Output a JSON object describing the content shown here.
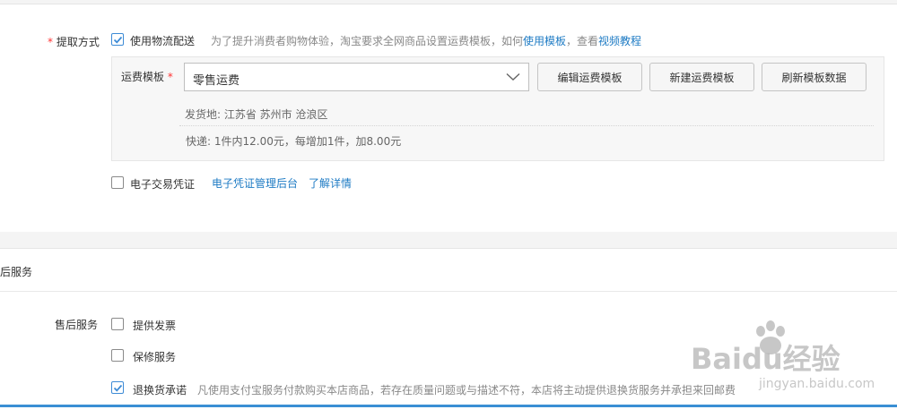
{
  "shipping": {
    "label": "提取方式",
    "required_mark": "*",
    "use_logistics_label": "使用物流配送",
    "use_logistics_checked": true,
    "hint_text": "为了提升消费者购物体验，淘宝要求全网商品设置运费模板，如何",
    "hint_link_template": "使用模板",
    "hint_sep": "，查看",
    "hint_link_video": "视频教程"
  },
  "template": {
    "label": "运费模板",
    "required_mark": "*",
    "selected": "零售运费",
    "edit_button": "编辑运费模板",
    "new_button": "新建运费模板",
    "refresh_button": "刷新模板数据",
    "ship_from": "发货地: 江苏省 苏州市 沧浪区",
    "express": "快递: 1件内12.00元，每增加1件，加8.00元"
  },
  "e_voucher": {
    "label": "电子交易凭证",
    "checked": false,
    "link_manage": "电子凭证管理后台",
    "link_details": "了解详情"
  },
  "after_sales": {
    "section_title": "后服务",
    "label": "售后服务",
    "invoice_label": "提供发票",
    "invoice_checked": false,
    "warranty_label": "保修服务",
    "warranty_checked": false,
    "return_label": "退换货承诺",
    "return_checked": true,
    "return_desc": "凡使用支付宝服务付款购买本店商品，若存在质量问题或与描述不符，本店将主动提供退换货服务并承担来回邮费"
  },
  "watermark": {
    "brand": "Baidu经验",
    "url": "jingyan.baidu.com"
  },
  "colors": {
    "accent": "#1e7bc4",
    "required": "#f33333",
    "checkbox_checked": "#3d8bd6"
  }
}
